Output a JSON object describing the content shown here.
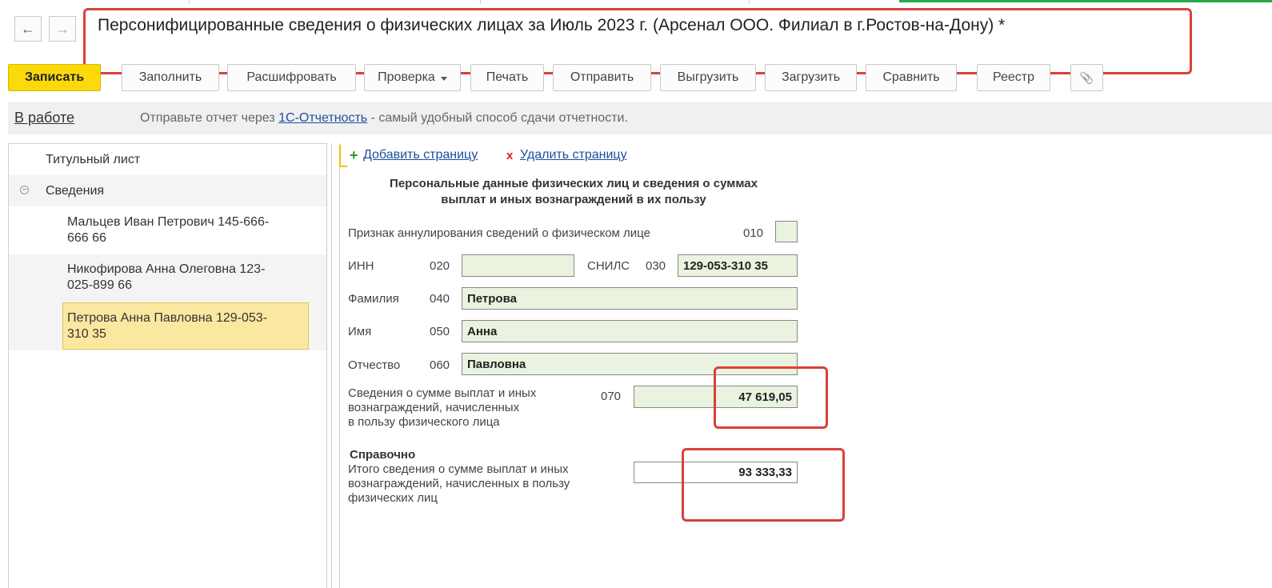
{
  "nav": {
    "back_icon": "←",
    "forward_icon": "→"
  },
  "window": {
    "title": "Персонифицированные сведения о физических лицах за Июль 2023 г. (Арсенал ООО. Филиал в г.Ростов-на-Дону) *"
  },
  "toolbar": {
    "save": "Записать",
    "fill": "Заполнить",
    "decode": "Расшифровать",
    "check": "Проверка",
    "print": "Печать",
    "send": "Отправить",
    "export": "Выгрузить",
    "import": "Загрузить",
    "compare": "Сравнить",
    "registry": "Реестр",
    "attach_icon": "📎"
  },
  "status": {
    "state": "В работе",
    "hint_before": "Отправьте отчет через ",
    "hint_link": "1С-Отчетность",
    "hint_after": " - самый удобный способ сдачи отчетности."
  },
  "sidebar": {
    "items": [
      {
        "label": "Титульный лист"
      },
      {
        "label": "Сведения"
      },
      {
        "label_l1": "Мальцев Иван Петрович 145-666-",
        "label_l2": "666 66"
      },
      {
        "label_l1": "Никофирова Анна Олеговна 123-",
        "label_l2": "025-899 66"
      },
      {
        "label_l1": "Петрова Анна Павловна 129-053-",
        "label_l2": "310 35"
      }
    ]
  },
  "form": {
    "add_page": "Добавить страницу",
    "delete_page": "Удалить страницу",
    "add_icon": "+",
    "delete_icon": "x",
    "section_title_l1": "Персональные данные физических лиц и сведения о суммах",
    "section_title_l2": "выплат и иных вознаграждений в их пользу",
    "annul_label": "Признак аннулирования сведений о физическом лице",
    "annul_code": "010",
    "inn_label": "ИНН",
    "inn_code": "020",
    "inn_value": "",
    "snils_label": "СНИЛС",
    "snils_code": "030",
    "snils_value": "129-053-310 35",
    "surname_label": "Фамилия",
    "surname_code": "040",
    "surname_value": "Петрова",
    "name_label": "Имя",
    "name_code": "050",
    "name_value": "Анна",
    "patronymic_label": "Отчество",
    "patronymic_code": "060",
    "patronymic_value": "Павловна",
    "payments_label_l1": "Сведения о сумме выплат и иных",
    "payments_label_l2": "вознаграждений, начисленных",
    "payments_label_l3": "в пользу физического лица",
    "payments_code": "070",
    "payments_value": "47 619,05",
    "reference_title": "Справочно",
    "total_label_l1": "Итого сведения о сумме выплат и иных",
    "total_label_l2": "вознаграждений, начисленных в пользу",
    "total_label_l3": "физических лиц",
    "total_value": "93 333,33"
  },
  "colors": {
    "accent_red": "#d9413c",
    "save_yellow": "#fcd90a",
    "field_green": "#e9f3df",
    "selection": "#fbe8a0"
  }
}
